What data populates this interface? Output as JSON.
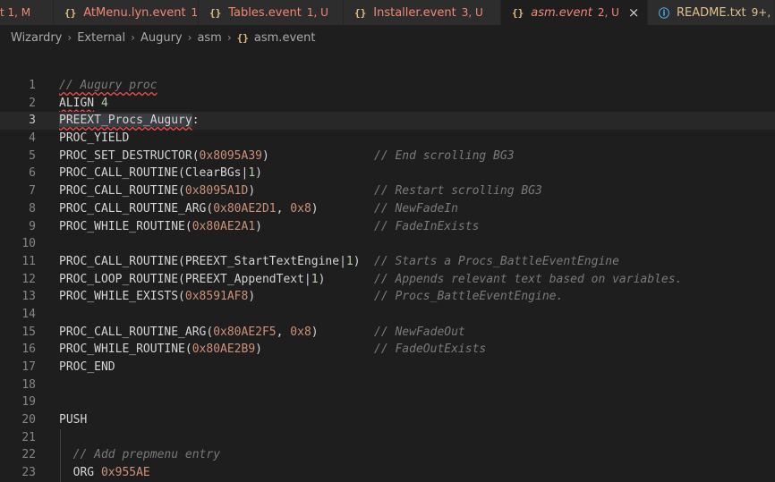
{
  "tabs": [
    {
      "name": "",
      "badge": "t 1, M",
      "status": "red",
      "icon": "",
      "width": 60
    },
    {
      "name": "AtMenu.lyn.event",
      "badge": "1",
      "status": "red",
      "icon": "{}",
      "width": 162
    },
    {
      "name": "Tables.event",
      "badge": "1, U",
      "status": "red",
      "icon": "{}",
      "width": 162
    },
    {
      "name": "Installer.event",
      "badge": "3, U",
      "status": "red",
      "icon": "{}",
      "width": 176
    },
    {
      "name": "asm.event",
      "badge": "2, U",
      "status": "red",
      "icon": "{}",
      "active": true,
      "close": "×",
      "width": 164
    },
    {
      "name": "README.txt",
      "badge": "9+, U",
      "status": "gold",
      "icon": "ⓘ",
      "width": 142
    }
  ],
  "breadcrumb": [
    "Wizardry",
    "External",
    "Augury",
    "asm"
  ],
  "breadcrumb_file": "asm.event",
  "breadcrumb_file_icon": "{}",
  "lines": [
    {
      "n": "1",
      "code": "// Augury proc",
      "comment": ""
    },
    {
      "n": "2",
      "code": "ALIGN 4",
      "comment": ""
    },
    {
      "n": "3",
      "code": "PREEXT_Procs_Augury:",
      "comment": ""
    },
    {
      "n": "4",
      "code": "PROC_YIELD",
      "comment": ""
    },
    {
      "n": "5",
      "code": "PROC_SET_DESTRUCTOR(0x8095A39)",
      "comment": "// End scrolling BG3"
    },
    {
      "n": "6",
      "code": "PROC_CALL_ROUTINE(ClearBGs|1)",
      "comment": ""
    },
    {
      "n": "7",
      "code": "PROC_CALL_ROUTINE(0x8095A1D)",
      "comment": "// Restart scrolling BG3"
    },
    {
      "n": "8",
      "code": "PROC_CALL_ROUTINE_ARG(0x80AE2D1, 0x8)",
      "comment": "// NewFadeIn"
    },
    {
      "n": "9",
      "code": "PROC_WHILE_ROUTINE(0x80AE2A1)",
      "comment": "// FadeInExists"
    },
    {
      "n": "10",
      "code": "",
      "comment": ""
    },
    {
      "n": "11",
      "code": "PROC_CALL_ROUTINE(PREEXT_StartTextEngine|1)",
      "comment": "// Starts a Procs_BattleEventEngine"
    },
    {
      "n": "12",
      "code": "PROC_LOOP_ROUTINE(PREEXT_AppendText|1)",
      "comment": "// Appends relevant text based on variables."
    },
    {
      "n": "13",
      "code": "PROC_WHILE_EXISTS(0x8591AF8)",
      "comment": "// Procs_BattleEventEngine."
    },
    {
      "n": "14",
      "code": "",
      "comment": ""
    },
    {
      "n": "15",
      "code": "PROC_CALL_ROUTINE_ARG(0x80AE2F5, 0x8)",
      "comment": "// NewFadeOut"
    },
    {
      "n": "16",
      "code": "PROC_WHILE_ROUTINE(0x80AE2B9)",
      "comment": "// FadeOutExists"
    },
    {
      "n": "17",
      "code": "PROC_END",
      "comment": ""
    },
    {
      "n": "18",
      "code": "",
      "comment": ""
    },
    {
      "n": "19",
      "code": "",
      "comment": ""
    },
    {
      "n": "20",
      "code": "PUSH",
      "comment": ""
    },
    {
      "n": "21",
      "code": "",
      "comment": ""
    },
    {
      "n": "22",
      "code": "  // Add prepmenu entry",
      "comment": ""
    },
    {
      "n": "23",
      "code": "  ORG 0x955AE",
      "comment": ""
    }
  ]
}
